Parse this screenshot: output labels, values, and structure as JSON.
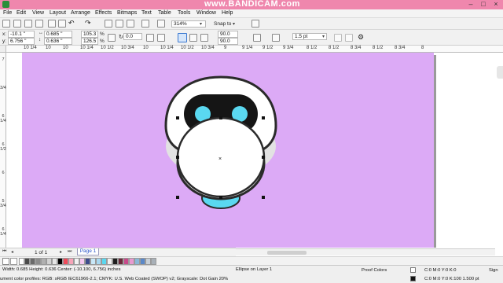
{
  "window": {
    "watermark": "www.BANDICAM.com"
  },
  "menu": [
    "File",
    "Edit",
    "View",
    "Layout",
    "Arrange",
    "Effects",
    "Bitmaps",
    "Text",
    "Table",
    "Tools",
    "Window",
    "Help"
  ],
  "toolbar": {
    "zoom_value": "314%",
    "snap_to": "Snap to"
  },
  "properties": {
    "x_label": "x:",
    "y_label": "y:",
    "x": "-10.1 \"",
    "y": "6.756 \"",
    "width": "0.685 \"",
    "height": "0.636 \"",
    "scale_w": "105.3",
    "scale_h": "126.5",
    "scale_unit": "%",
    "rotation": "0.0",
    "start_angle": "90.0",
    "end_angle": "90.0",
    "outline_width": "1.5 pt"
  },
  "ruler": {
    "top": [
      "10 1/4",
      "10",
      "10",
      "10 1/4",
      "10 1/2",
      "10 3/4",
      "10",
      "10 1/4",
      "10 1/2",
      "10 3/4",
      "9",
      "9 1/4",
      "9 1/2",
      "9 3/4",
      "8 1/2",
      "8 1/2",
      "8 3/4",
      "8 1/2",
      "8 3/4",
      "8"
    ],
    "left": [
      "7",
      "3/4",
      "6 1/4",
      "6 1/2",
      "6",
      "5 3/4",
      "6 1/4"
    ]
  },
  "pages": {
    "count": "1 of 1",
    "current_tab": "Page 1"
  },
  "palette_colors": [
    "#ffffff",
    "#4a4a4a",
    "#6b6b6b",
    "#8c8c8c",
    "#b0b0b0",
    "#d2d2d2",
    "#e6e6e6",
    "#000000",
    "#ef4a5a",
    "#f7a4b8",
    "#f2f2f2",
    "#f6c9f0",
    "#3c4c8c",
    "#c9e8f8",
    "#a8d8f0",
    "#5ad8f0",
    "#f0f0f0",
    "#1e1e1e",
    "#6a2a3a",
    "#c84a8a",
    "#e89ad0",
    "#8ab8d8",
    "#5a88c8",
    "#c8d0d8",
    "#a8b0b8"
  ],
  "status": {
    "dimensions": "Width: 0.685  Height: 0.636  Center: (-10.100, 6.756)  inches",
    "selection": "Ellipse on Layer 1",
    "color_profiles": "ument color profiles: RGB: sRGB IEC61966-2.1; CMYK: U.S. Web Coated (SWOP) v2; Grayscale: Dot Gain 20%",
    "proof_colors": "Proof Colors",
    "fill_value": "C:0 M:0 Y:0 K:0",
    "outline_value": "C:0 M:0 Y:0 K:100   1.500 pt",
    "sign_label": "Sign"
  },
  "colors": {
    "title_bar": "#ef87ad",
    "page_background": "#dcaaf6",
    "robot_outline": "#2a2a2a",
    "robot_eye": "#5ad8f0",
    "robot_body": "#ffffff",
    "robot_shadow": "#e2e2e2"
  },
  "icons": [
    "app-icon",
    "new-icon",
    "open-icon",
    "save-icon",
    "print-icon",
    "cut-icon",
    "copy-icon",
    "paste-icon",
    "undo-icon",
    "redo-icon",
    "import-icon",
    "export-icon",
    "lock-icon",
    "mirror-h-icon",
    "mirror-v-icon",
    "ellipse-icon",
    "pie-icon",
    "arc-icon",
    "to-front-icon",
    "to-back-icon",
    "options-icon",
    "first-page-icon",
    "prev-page-icon",
    "next-page-icon",
    "last-page-icon",
    "no-color-icon",
    "fill-bucket-icon",
    "outline-pen-icon"
  ]
}
